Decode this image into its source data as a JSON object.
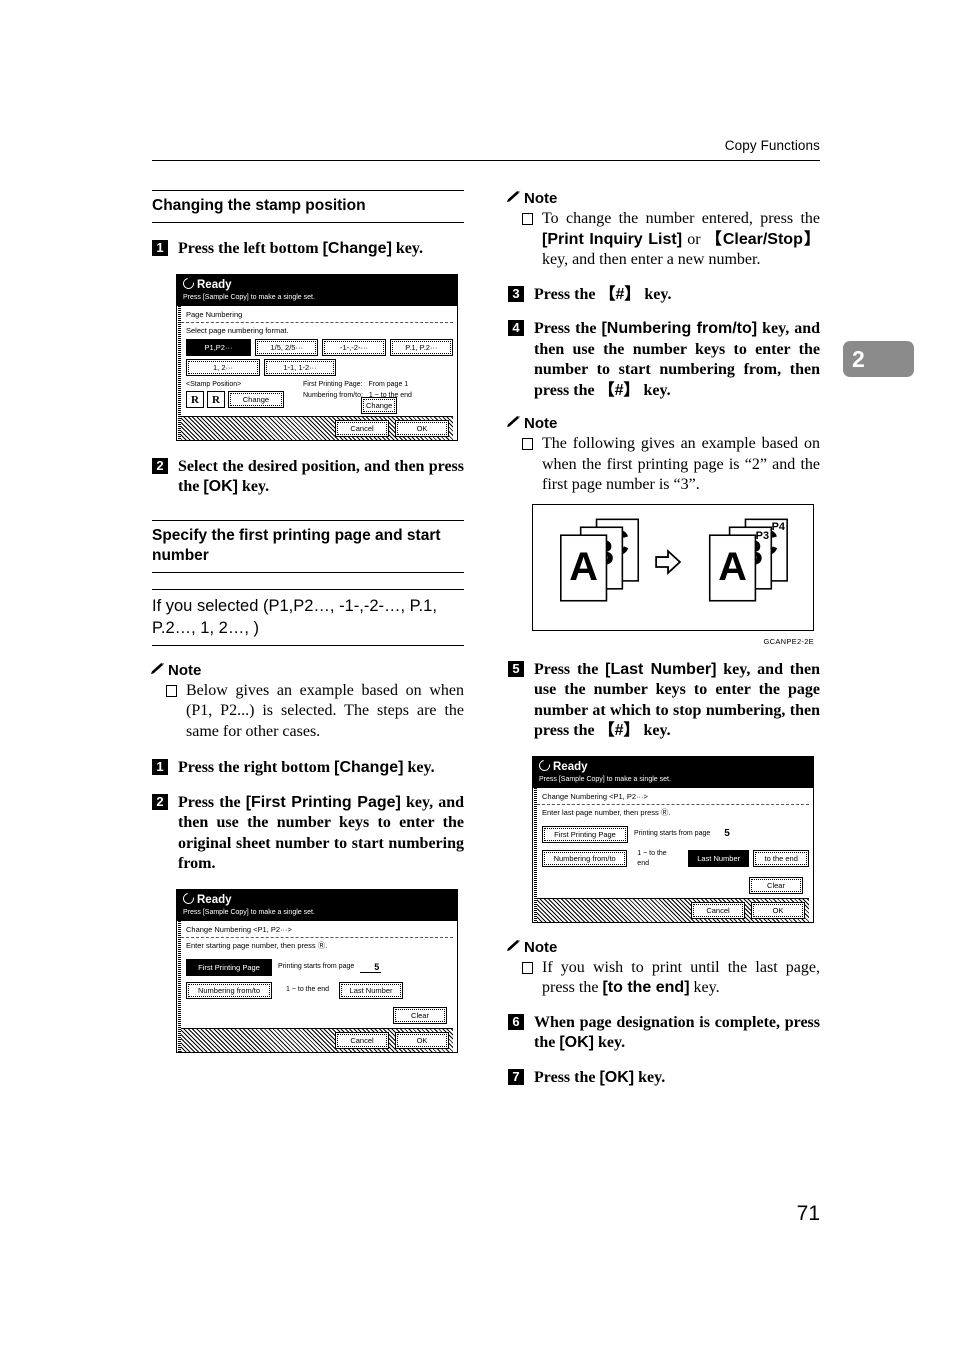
{
  "page": {
    "running_head": "Copy Functions",
    "page_number": "71",
    "chapter_tab": "2",
    "accent_gray": "#8b8b8b"
  },
  "left_column": {
    "section_heading": "Changing the stamp position",
    "step1": {
      "num": "1",
      "text_a": "Press the left bottom ",
      "key": "[Change]",
      "text_b": " key."
    },
    "lcd1": {
      "status_title": "Ready",
      "status_sub": "Press [Sample Copy] to make a single set.",
      "screen_title": "Page Numbering",
      "instruction": "Select page numbering format.",
      "format_buttons_row1": [
        "P1,P2···",
        "1/5, 2/5···",
        "-1-,-2-···",
        "P.1, P.2···"
      ],
      "format_buttons_row2": [
        "1, 2···",
        "1-1, 1-2···"
      ],
      "selected_format": "P1,P2···",
      "stamp_position_label": "<Stamp Position>",
      "stamp_keys": [
        "R",
        "R"
      ],
      "change_left": "Change",
      "first_printing_page_label": "First Printing Page:",
      "first_printing_page_value": "From page    1",
      "numbering_from_to_label": "Numbering from/to:",
      "numbering_from_to_value": "1 ~ to the end",
      "change_right": "Change",
      "cancel": "Cancel",
      "ok": "OK"
    },
    "step2": {
      "num": "2",
      "text_a": "Select the desired position, and then press the ",
      "key": "[OK]",
      "text_b": " key."
    },
    "section_heading2": "Specify the first printing page and start number",
    "subhead": "If you selected (P1,P2…, -1-,-2-…, P.1, P.2…, 1, 2…, )",
    "note1": {
      "label": "Note",
      "items": [
        "Below gives an example based on when (P1, P2...) is selected. The steps are the same for other cases."
      ]
    },
    "step3": {
      "num": "1",
      "text_a": "Press the right bottom ",
      "key": "[Change]",
      "text_b": " key."
    },
    "step4": {
      "num": "2",
      "text_a": "Press the ",
      "key": "[First Printing Page]",
      "text_b": " key, and then use the number keys to enter the original sheet number to start numbering from."
    },
    "lcd2": {
      "status_title": "Ready",
      "status_sub": "Press [Sample Copy] to make a single set.",
      "screen_title": "Change Numbering   <P1, P2···>",
      "instruction": "Enter starting page number, then press Ⓡ.",
      "btn_first_printing_page": "First Printing Page",
      "first_printing_text": "Printing starts from page",
      "first_printing_value": "5",
      "btn_numbering_from_to": "Numbering from/to",
      "range_text": "1  ~ to the end",
      "btn_last_number": "Last Number",
      "btn_clear": "Clear",
      "cancel": "Cancel",
      "ok": "OK"
    }
  },
  "right_column": {
    "note1": {
      "label": "Note",
      "item_a": "To change the number entered, press the ",
      "key1": "[Print Inquiry List]",
      "item_b": " or ",
      "key2": "【Clear/Stop】",
      "item_c": " key, and then enter a new number."
    },
    "step3": {
      "num": "3",
      "text_a": "Press the ",
      "key": "【#】",
      "text_b": " key."
    },
    "step4": {
      "num": "4",
      "text_a": "Press the ",
      "key": "[Numbering from/to]",
      "text_b": " key, and then use the number keys to enter the number to start numbering from, then press the ",
      "key2": "【#】",
      "text_c": " key."
    },
    "note2": {
      "label": "Note",
      "items": [
        "The following gives an example based on when the first printing page is “2” and the first page number is “3”."
      ]
    },
    "figure": {
      "caption": "GCANPE2-2E",
      "left_letters": [
        "A",
        "B",
        "C"
      ],
      "right_letters": [
        "A",
        "B",
        "C"
      ],
      "right_stamps": [
        "P3",
        "P4"
      ],
      "arrow": "⇨"
    },
    "step5": {
      "num": "5",
      "text_a": "Press the ",
      "key": "[Last Number]",
      "text_b": " key, and then use the number keys to enter the page number at which to stop numbering, then press the ",
      "key2": "【#】",
      "text_c": " key."
    },
    "lcd3": {
      "status_title": "Ready",
      "status_sub": "Press [Sample Copy] to make a single set.",
      "screen_title": "Change Numbering   <P1, P2···>",
      "instruction": "Enter last page number, then press Ⓡ.",
      "btn_first_printing_page": "First Printing Page",
      "first_printing_text": "Printing starts from page",
      "first_printing_value": "5",
      "btn_numbering_from_to": "Numbering from/to",
      "range_text": "1  ~ to the end",
      "btn_last_number": "Last Number",
      "btn_to_the_end": "to the end",
      "btn_clear": "Clear",
      "cancel": "Cancel",
      "ok": "OK"
    },
    "note3": {
      "label": "Note",
      "item_a": "If you wish to print until the last page, press the ",
      "key": "[to the end]",
      "item_b": " key."
    },
    "step6": {
      "num": "6",
      "text_a": "When page designation is complete, press the ",
      "key": "[OK]",
      "text_b": " key."
    },
    "step7": {
      "num": "7",
      "text_a": "Press the ",
      "key": "[OK]",
      "text_b": " key."
    }
  }
}
